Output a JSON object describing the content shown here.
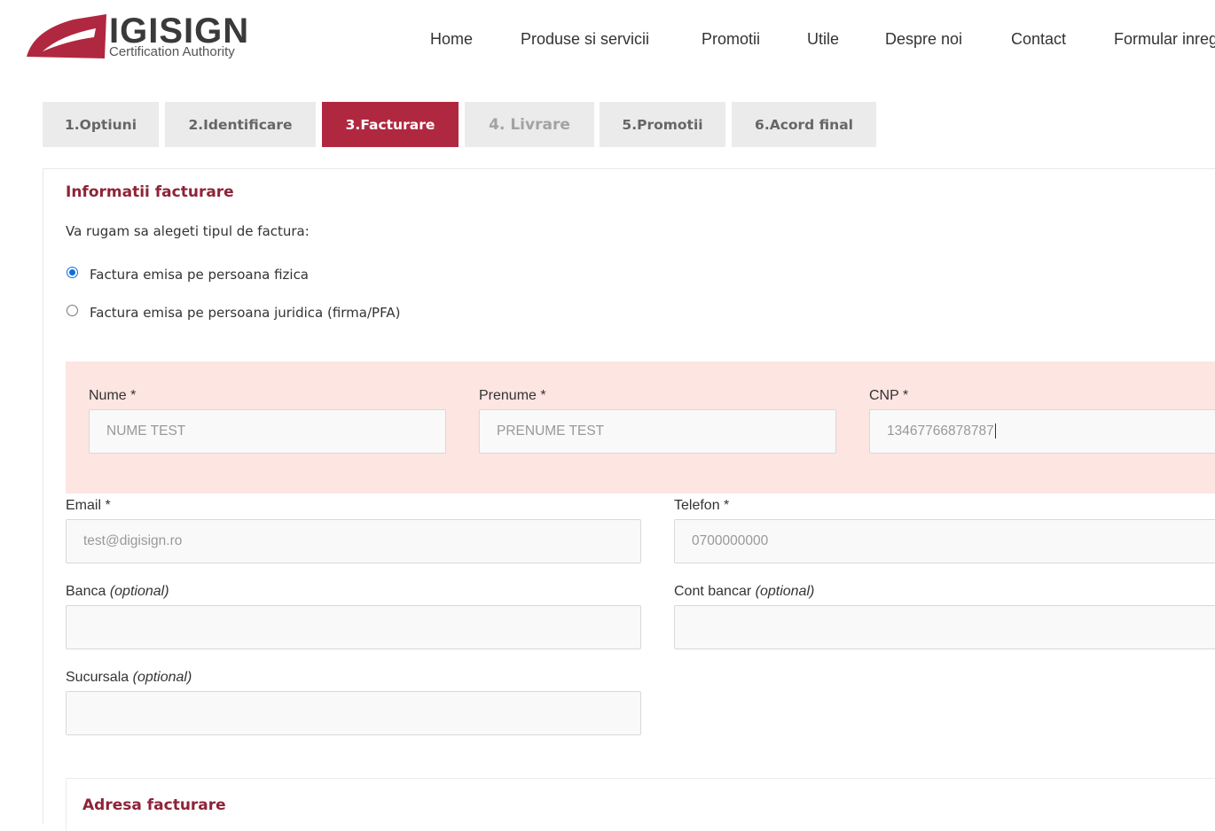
{
  "brand": {
    "logo_text": "IGISIGN",
    "logo_subtitle": "Certification Authority",
    "accent_color": "#b0283f",
    "title_color": "#8e2337"
  },
  "nav": {
    "items": [
      "Home",
      "Produse si servicii",
      "Promotii",
      "Utile",
      "Despre noi",
      "Contact",
      "Formular inreg"
    ]
  },
  "steps": {
    "tabs": [
      "1.Optiuni",
      "2.Identificare",
      "3.Facturare",
      "4. Livrare",
      "5.Promotii",
      "6.Acord final"
    ],
    "active": "3.Facturare",
    "disabled": "4. Livrare"
  },
  "billing": {
    "title": "Informatii facturare",
    "prompt": "Va rugam sa alegeti tipul de factura:",
    "options": [
      {
        "label": "Factura emisa pe persoana fizica",
        "checked": true
      },
      {
        "label": "Factura emisa pe persoana juridica (firma/PFA)",
        "checked": false
      }
    ]
  },
  "fields": {
    "nume": {
      "label": "Nume *",
      "value": "NUME TEST"
    },
    "prenume": {
      "label": "Prenume *",
      "value": "PRENUME TEST"
    },
    "cnp": {
      "label": "CNP *",
      "value": "13467766878787"
    },
    "email": {
      "label": "Email *",
      "value": "test@digisign.ro"
    },
    "telefon": {
      "label": "Telefon *",
      "value": "0700000000"
    },
    "banca": {
      "label": "Banca",
      "optional": "(optional)",
      "value": ""
    },
    "cont": {
      "label": "Cont bancar",
      "optional": "(optional)",
      "value": ""
    },
    "sucursala": {
      "label": "Sucursala",
      "optional": "(optional)",
      "value": ""
    }
  },
  "address": {
    "title": "Adresa facturare"
  }
}
